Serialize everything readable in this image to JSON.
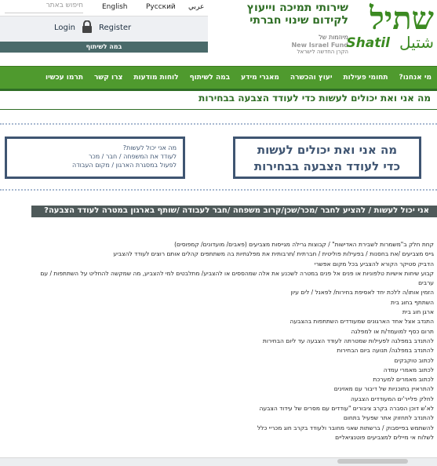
{
  "topbar": {
    "search_placeholder": "חיפוש באתר",
    "lang_english": "English",
    "lang_russian": "Русский",
    "lang_arabic": "عربي",
    "login": "Login",
    "register": "Register",
    "stage": "במה לשיתוף"
  },
  "logo": {
    "slogan_line1": "שירותי תמיכה וייעוץ",
    "slogan_line2": "לקידום שינוי חברתי",
    "fund_he": "מיוזמות של",
    "fund_en": "New Israel Fund",
    "fund_he2": "הקרן החדשה לישראל",
    "name_he": "שתיל",
    "name_en": "Shatil",
    "name_ar": "شتيل"
  },
  "nav": {
    "items": [
      "מי אנחנו?",
      "תחומי פעילות",
      "יעוץ והכשרה",
      "מאגרי מידע",
      "במה לשיתוף",
      "לוחות מודעות",
      "צרו קשר",
      "תרמו עכשיו"
    ]
  },
  "page": {
    "title": "מה אני ואת יכולים לעשות כדי לעודד הצבעה בבחירות",
    "box_right_line1": "מה אני ואת יכולים לעשות",
    "box_right_line2": "כדי לעודד הצבעה בבחירות",
    "box_left_line1": "מה אני יכול לעשות?",
    "box_left_line2": "לעודד את המשפחה / חבר / מכר",
    "box_left_line3": "לפעול במסגרת הארגון / מקום העבודה",
    "highlight": "אני יכול לעשות / להציע לחבר /מכר/שכן/קרוב משפחה /חבר לעבודה /שותף בארגון במטרה לעודד הצבעה?"
  },
  "list": [
    "קחת חלק ב\"משמרות לשבירת האדישות\" / קבוצות גרילה מגייסות מצביעים (פאבים/ מועדונים/ קמפוסים)",
    "גייס מצביעים /את בחסנות / בפעילות פוליטית / חברתית /תרבותית את מפלגתיות בה משתתפים קהלים אותם רוצים לעודד להצביע",
    "הדביק סטיקר הקורא להצביע בכל מקום אפשרי",
    "קבוע שיחות אישיות טלפוניות או פנים אל פנים במטרה לשכנע את אלה שמהססים או להצביע/ מתלבטים למי להצביע, מה שמקשה להחליט על השתתפות / עם",
    "ערבים",
    "הזמין אותו/ה ללכת יחד לאסיפת בחירות/ לפאנל / לים עיון",
    "השתתף בחוג בית",
    "ארגן חוג בית",
    "התנדב אצל אחד הארגונים שמעודדים השתתפות בהצבעה",
    "תרום כסף למועמד/ת או למפלגה",
    "להתנדב במפלגה לפעילות שמטרתה לעודד הצבעה עד ליום הבחירות",
    "להתנדב במפלגה/ תנועה ביום הבחירות",
    "לכתוב טוקבקים",
    "לכתוב מאמרי עמדה",
    "לכתוב מאמרים למערכת",
    "להתראיין בתוכניות של דיבור עם מאזינים",
    "לחלק פלייר'ים המעודדים הצבעה",
    "לא'ש דוכן הסברה בקרב ציבורים \"עודדים עם מסרים של עידוד הצבעה",
    "להתנדב לתחזוק אתר שפעיל בתחום",
    "להשתמש בפייסבוק / ברשתות שאני מחובר ולעודד בקרב חוג מכריי כלל",
    "לשלוח אי מיילים למצביעים פוטנציאליים"
  ]
}
